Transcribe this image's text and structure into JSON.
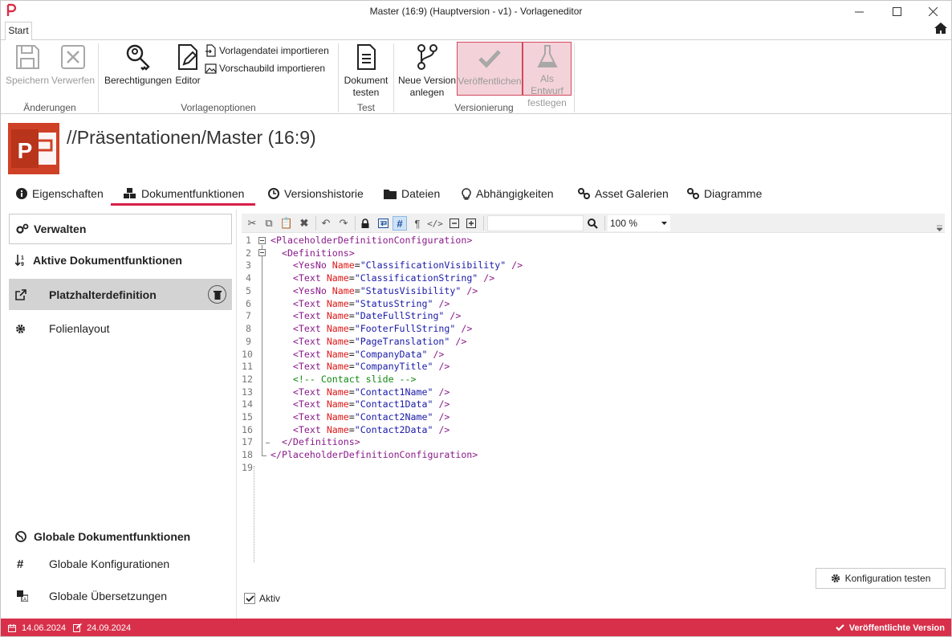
{
  "window": {
    "title": "Master (16:9) (Hauptversion - v1) - Vorlageneditor"
  },
  "ribbon": {
    "tab": "Start",
    "buttons": {
      "save": "Speichern",
      "discard": "Verwerfen",
      "permissions": "Berechtigungen",
      "editor": "Editor",
      "import_template": "Vorlagendatei importieren",
      "import_preview": "Vorschaubild importieren",
      "test_doc_1": "Dokument",
      "test_doc_2": "testen",
      "new_version_1": "Neue Version",
      "new_version_2": "anlegen",
      "publish": "Veröffentlichen",
      "draft_1": "Als Entwurf",
      "draft_2": "festlegen"
    },
    "groups": {
      "changes": "Änderungen",
      "template_options": "Vorlagenoptionen",
      "test": "Test",
      "versioning": "Versionierung"
    }
  },
  "header": {
    "title": "//Präsentationen/Master (16:9)"
  },
  "tabs": [
    {
      "label": "Eigenschaften"
    },
    {
      "label": "Dokumentfunktionen"
    },
    {
      "label": "Versionshistorie"
    },
    {
      "label": "Dateien"
    },
    {
      "label": "Abhängigkeiten"
    },
    {
      "label": "Asset Galerien"
    },
    {
      "label": "Diagramme"
    }
  ],
  "left_panel": {
    "manage": "Verwalten",
    "active_header": "Aktive Dokumentfunktionen",
    "items": [
      {
        "label": "Platzhalterdefinition"
      },
      {
        "label": "Folienlayout"
      }
    ],
    "global_header": "Globale Dokumentfunktionen",
    "global_items": [
      {
        "label": "Globale Konfigurationen"
      },
      {
        "label": "Globale Übersetzungen"
      }
    ]
  },
  "editor": {
    "zoom": "100 %",
    "search_value": "",
    "line_numbers": [
      "1",
      "2",
      "3",
      "4",
      "5",
      "6",
      "7",
      "8",
      "9",
      "10",
      "11",
      "12",
      "13",
      "14",
      "15",
      "16",
      "17",
      "18",
      "19"
    ],
    "tags": {
      "root_open": "PlaceholderDefinitionConfiguration",
      "defs_open": "Definitions",
      "defs_close": "/Definitions",
      "root_close": "/PlaceholderDefinitionConfiguration",
      "yesno": "YesNo",
      "text": "Text",
      "attr": "Name"
    },
    "comment": "<!-- Contact slide -->",
    "names": [
      "\"ClassificationVisibility\"",
      "\"ClassificationString\"",
      "\"StatusVisibility\"",
      "\"StatusString\"",
      "\"DateFullString\"",
      "\"FooterFullString\"",
      "\"PageTranslation\"",
      "\"CompanyData\"",
      "\"CompanyTitle\"",
      "\"Contact1Name\"",
      "\"Contact1Data\"",
      "\"Contact2Name\"",
      "\"Contact2Data\""
    ],
    "active_label": "Aktiv",
    "active_checked": true,
    "test_button": "Konfiguration testen"
  },
  "status": {
    "created": "14.06.2024",
    "modified": "24.09.2024",
    "published": "Veröffentlichte Version"
  },
  "colors": {
    "accent": "#d8304a",
    "highlight_bg": "#f3d3d9",
    "powerpoint": "#cf4126"
  }
}
